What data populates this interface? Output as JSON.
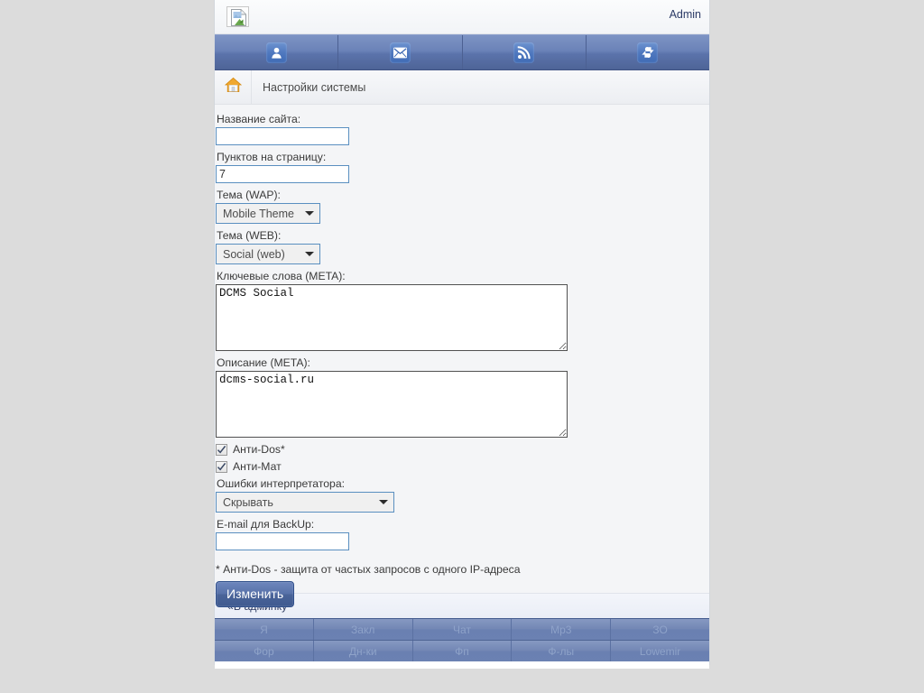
{
  "header": {
    "logo_icon": "broken-image-icon",
    "admin_label": "Admin"
  },
  "icon_nav": [
    {
      "icon": "user-icon",
      "name": "profile"
    },
    {
      "icon": "envelope-icon",
      "name": "mail"
    },
    {
      "icon": "rss-icon",
      "name": "feed"
    },
    {
      "icon": "refresh-icon",
      "name": "refresh"
    }
  ],
  "breadcrumb": {
    "home_icon": "home-icon",
    "title": "Настройки системы"
  },
  "form": {
    "site_name": {
      "label": "Название сайта:",
      "value": "",
      "placeholder": ""
    },
    "items_per_page": {
      "label": "Пунктов на страницу:",
      "value": "7"
    },
    "theme_wap": {
      "label": "Тема (WAP):",
      "value": "Mobile Theme",
      "options": [
        "Mobile Theme"
      ]
    },
    "theme_web": {
      "label": "Тема (WEB):",
      "value": "Social (web)",
      "options": [
        "Social (web)"
      ]
    },
    "keywords_meta": {
      "label": "Ключевые слова (META):",
      "value": "DCMS Social"
    },
    "description_meta": {
      "label": "Описание (META):",
      "value": "dcms-social.ru"
    },
    "anti_dos": {
      "label": "Анти-Dos*",
      "checked": true
    },
    "anti_mat": {
      "label": "Анти-Мат",
      "checked": true
    },
    "interpreter_errors": {
      "label": "Ошибки интерпретатора:",
      "value": "Скрывать",
      "options": [
        "Скрывать"
      ]
    },
    "backup_email": {
      "label": "E-mail для BackUp:",
      "value": ""
    },
    "footnote": "* Анти-Dos - защита от частых запросов с одного IP-адреса",
    "submit_label": "Изменить"
  },
  "admin_footer": {
    "link_label": "«В админку"
  },
  "grid_nav": {
    "row1": [
      "Я",
      "Закл",
      "Чат",
      "Mp3",
      "ЗО"
    ],
    "row2": [
      "Фор",
      "Дн-ки",
      "Фп",
      "Ф-лы",
      "Lowemir"
    ]
  },
  "colors": {
    "accent_blue": "#5872a9",
    "nav_blue": "#6b83b8",
    "input_border": "#5a8fc0",
    "page_bg": "#f4f5f7",
    "canvas": "#dcdcdc"
  }
}
